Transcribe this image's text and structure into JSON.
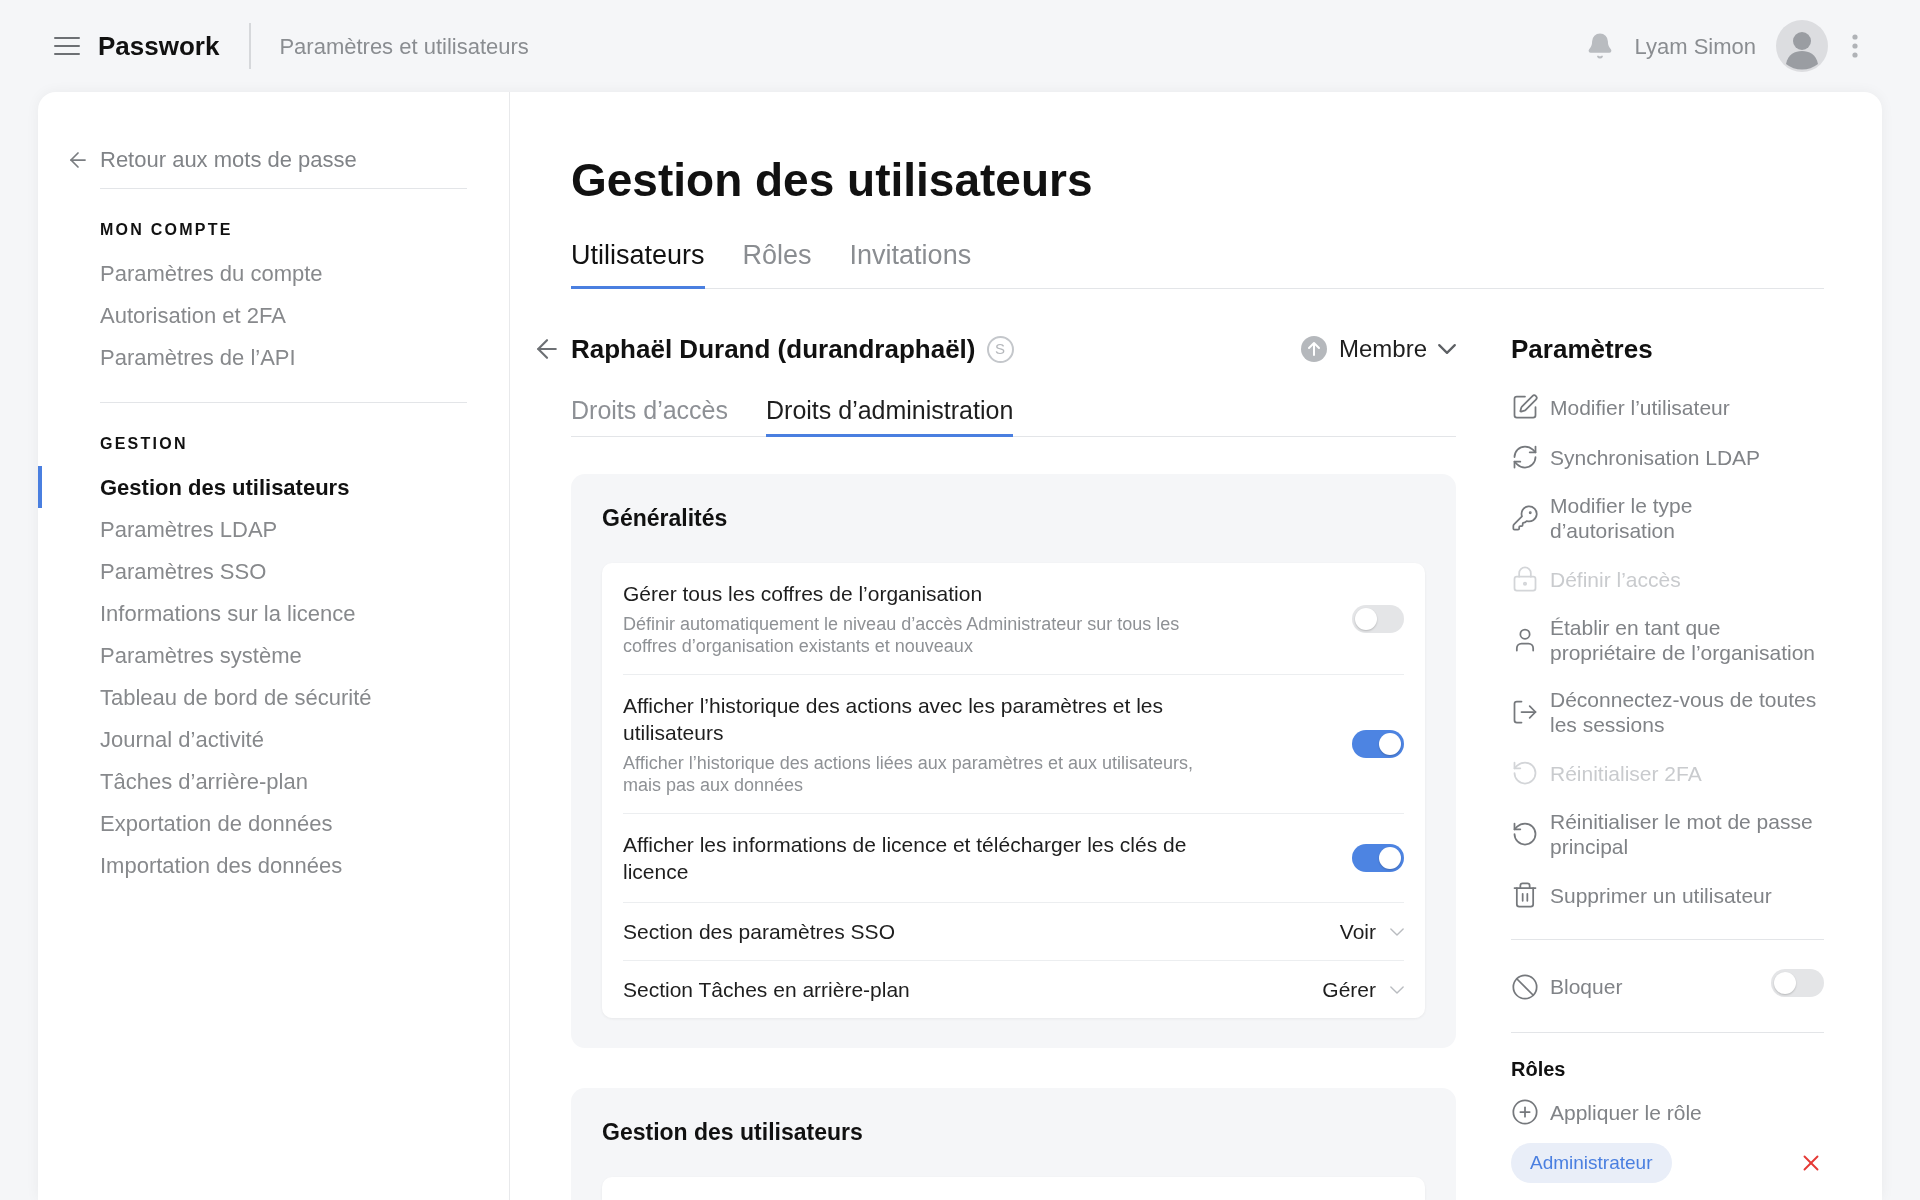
{
  "header": {
    "app_name": "Passwork",
    "breadcrumb": "Paramètres et utilisateurs",
    "user_name": "Lyam Simon"
  },
  "sidebar": {
    "back_link": "Retour aux mots de passe",
    "sections": [
      {
        "title": "MON COMPTE",
        "items": [
          {
            "label": "Paramètres du compte",
            "selected": false
          },
          {
            "label": "Autorisation et 2FA",
            "selected": false
          },
          {
            "label": "Paramètres de l’API",
            "selected": false
          }
        ]
      },
      {
        "title": "GESTION",
        "items": [
          {
            "label": "Gestion des utilisateurs",
            "selected": true
          },
          {
            "label": "Paramètres LDAP",
            "selected": false
          },
          {
            "label": "Paramètres SSO",
            "selected": false
          },
          {
            "label": "Informations sur la licence",
            "selected": false
          },
          {
            "label": "Paramètres système",
            "selected": false
          },
          {
            "label": "Tableau de bord de sécurité",
            "selected": false
          },
          {
            "label": "Journal d’activité",
            "selected": false
          },
          {
            "label": "Tâches d’arrière-plan",
            "selected": false
          },
          {
            "label": "Exportation de données",
            "selected": false
          },
          {
            "label": "Importation des données",
            "selected": false
          }
        ]
      }
    ]
  },
  "main": {
    "title": "Gestion des utilisateurs",
    "tabs": [
      {
        "label": "Utilisateurs",
        "selected": true
      },
      {
        "label": "Rôles",
        "selected": false
      },
      {
        "label": "Invitations",
        "selected": false
      }
    ],
    "user": {
      "name": "Raphaël Durand (durandraphaël)",
      "badge": "S",
      "role": "Membre"
    },
    "user_tabs": [
      {
        "label": "Droits d’accès",
        "selected": false
      },
      {
        "label": "Droits d’administration",
        "selected": true
      }
    ],
    "sections": [
      {
        "title": "Généralités",
        "rows": [
          {
            "kind": "toggle",
            "label": "Gérer tous les coffres de l’organisation",
            "description": "Définir automatiquement le niveau d’accès Administrateur sur tous les coffres d’organisation existants et nouveaux",
            "on": false
          },
          {
            "kind": "toggle",
            "label": "Afficher l’historique des actions avec les paramètres et les utilisateurs",
            "description": "Afficher l’historique des actions liées aux paramètres et aux utilisateurs, mais pas aux données",
            "on": true
          },
          {
            "kind": "toggle",
            "label": "Afficher les informations de licence et télécharger les clés de licence",
            "on": true
          },
          {
            "kind": "select",
            "label": "Section des paramètres SSO",
            "value": "Voir"
          },
          {
            "kind": "select",
            "label": "Section Tâches en arrière-plan",
            "value": "Gérer"
          }
        ]
      },
      {
        "title": "Gestion des utilisateurs"
      }
    ]
  },
  "settings_panel": {
    "title": "Paramètres",
    "actions": [
      {
        "kind": "edit",
        "label": "Modifier l’utilisateur",
        "disabled": false
      },
      {
        "kind": "sync",
        "label": "Synchronisation LDAP",
        "disabled": false
      },
      {
        "kind": "key",
        "label": "Modifier le type d’autorisation",
        "disabled": false
      },
      {
        "kind": "lock",
        "label": "Définir l’accès",
        "disabled": true
      },
      {
        "kind": "owner",
        "label": "Établir en tant que propriétaire de l’organisation",
        "disabled": false
      },
      {
        "kind": "logout",
        "label": "Déconnectez-vous de toutes les sessions",
        "disabled": false
      },
      {
        "kind": "reset",
        "label": "Réinitialiser 2FA",
        "disabled": true
      },
      {
        "kind": "reset",
        "label": "Réinitialiser le mot de passe principal",
        "disabled": false
      },
      {
        "kind": "delete",
        "label": "Supprimer un utilisateur",
        "disabled": false
      }
    ],
    "block": {
      "label": "Bloquer",
      "on": false
    },
    "roles_title": "Rôles",
    "apply_role": "Appliquer le rôle",
    "roles": [
      {
        "label": "Administrateur"
      }
    ]
  }
}
